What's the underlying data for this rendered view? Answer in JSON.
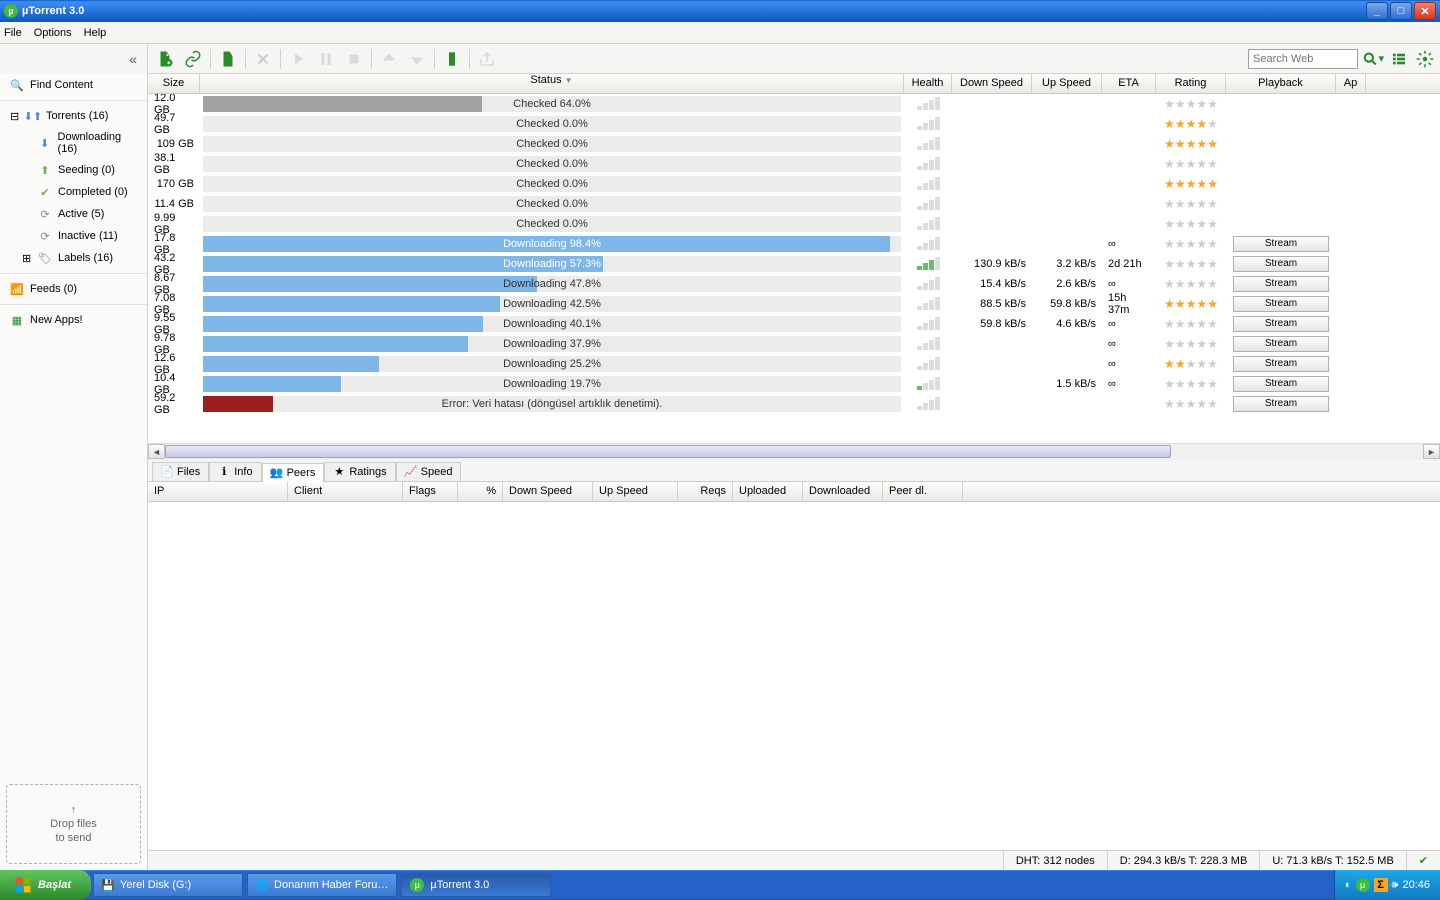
{
  "window": {
    "title": "µTorrent 3.0"
  },
  "menu": [
    "File",
    "Options",
    "Help"
  ],
  "search": {
    "placeholder": "Search Web"
  },
  "sidebar": {
    "find": "Find Content",
    "torrents": "Torrents (16)",
    "downloading": "Downloading (16)",
    "seeding": "Seeding (0)",
    "completed": "Completed (0)",
    "active": "Active (5)",
    "inactive": "Inactive (11)",
    "labels": "Labels (16)",
    "feeds": "Feeds (0)",
    "newapps": "New Apps!",
    "drop1": "Drop files",
    "drop2": "to send"
  },
  "columns": [
    "Size",
    "Status",
    "Health",
    "Down Speed",
    "Up Speed",
    "ETA",
    "Rating",
    "Playback",
    "Ap"
  ],
  "rows": [
    {
      "size": "12.0 GB",
      "status": "Checked 64.0%",
      "pct": 40,
      "barclass": "grey",
      "txtclass": "",
      "health": [
        0,
        0,
        0,
        0
      ],
      "down": "",
      "up": "",
      "eta": "",
      "stars": 0,
      "stream": false
    },
    {
      "size": "49.7 GB",
      "status": "Checked 0.0%",
      "pct": 0,
      "barclass": "grey",
      "txtclass": "",
      "health": [
        0,
        0,
        0,
        0
      ],
      "down": "",
      "up": "",
      "eta": "",
      "stars": 4,
      "stream": false
    },
    {
      "size": "109 GB",
      "status": "Checked 0.0%",
      "pct": 0,
      "barclass": "grey",
      "txtclass": "",
      "health": [
        0,
        0,
        0,
        0
      ],
      "down": "",
      "up": "",
      "eta": "",
      "stars": 5,
      "stream": false
    },
    {
      "size": "38.1 GB",
      "status": "Checked 0.0%",
      "pct": 0,
      "barclass": "grey",
      "txtclass": "",
      "health": [
        0,
        0,
        0,
        0
      ],
      "down": "",
      "up": "",
      "eta": "",
      "stars": 0,
      "stream": false
    },
    {
      "size": "170 GB",
      "status": "Checked 0.0%",
      "pct": 0,
      "barclass": "grey",
      "txtclass": "",
      "health": [
        0,
        0,
        0,
        0
      ],
      "down": "",
      "up": "",
      "eta": "",
      "stars": 5,
      "stream": false
    },
    {
      "size": "11.4 GB",
      "status": "Checked 0.0%",
      "pct": 0,
      "barclass": "grey",
      "txtclass": "",
      "health": [
        0,
        0,
        0,
        0
      ],
      "down": "",
      "up": "",
      "eta": "",
      "stars": 0,
      "stream": false
    },
    {
      "size": "9.99 GB",
      "status": "Checked 0.0%",
      "pct": 0,
      "barclass": "grey",
      "txtclass": "",
      "health": [
        0,
        0,
        0,
        0
      ],
      "down": "",
      "up": "",
      "eta": "",
      "stars": 0,
      "stream": false
    },
    {
      "size": "17.8 GB",
      "status": "Downloading 98.4%",
      "pct": 98.4,
      "barclass": "blue",
      "txtclass": "white",
      "health": [
        0,
        0,
        0,
        0
      ],
      "down": "",
      "up": "",
      "eta": "∞",
      "stars": 0,
      "stream": true
    },
    {
      "size": "43.2 GB",
      "status": "Downloading 57.3%",
      "pct": 57.3,
      "barclass": "blue",
      "txtclass": "white",
      "health": [
        1,
        1,
        1,
        0
      ],
      "down": "130.9 kB/s",
      "up": "3.2 kB/s",
      "eta": "2d 21h",
      "stars": 0,
      "stream": true
    },
    {
      "size": "8.67 GB",
      "status": "Downloading 47.8%",
      "pct": 47.8,
      "barclass": "blue",
      "txtclass": "",
      "health": [
        0,
        0,
        0,
        0
      ],
      "down": "15.4 kB/s",
      "up": "2.6 kB/s",
      "eta": "∞",
      "stars": 0,
      "stream": true
    },
    {
      "size": "7.08 GB",
      "status": "Downloading 42.5%",
      "pct": 42.5,
      "barclass": "blue",
      "txtclass": "",
      "health": [
        0,
        0,
        0,
        0
      ],
      "down": "88.5 kB/s",
      "up": "59.8 kB/s",
      "eta": "15h 37m",
      "stars": 5,
      "stream": true
    },
    {
      "size": "9.55 GB",
      "status": "Downloading 40.1%",
      "pct": 40.1,
      "barclass": "blue",
      "txtclass": "",
      "health": [
        0,
        0,
        0,
        0
      ],
      "down": "59.8 kB/s",
      "up": "4.6 kB/s",
      "eta": "∞",
      "stars": 0,
      "stream": true
    },
    {
      "size": "9.78 GB",
      "status": "Downloading 37.9%",
      "pct": 37.9,
      "barclass": "blue",
      "txtclass": "",
      "health": [
        0,
        0,
        0,
        0
      ],
      "down": "",
      "up": "",
      "eta": "∞",
      "stars": 0,
      "stream": true
    },
    {
      "size": "12.6 GB",
      "status": "Downloading 25.2%",
      "pct": 25.2,
      "barclass": "blue",
      "txtclass": "",
      "health": [
        0,
        0,
        0,
        0
      ],
      "down": "",
      "up": "",
      "eta": "∞",
      "stars": 2,
      "stream": true
    },
    {
      "size": "10.4 GB",
      "status": "Downloading 19.7%",
      "pct": 19.7,
      "barclass": "blue",
      "txtclass": "",
      "health": [
        1,
        0,
        0,
        0
      ],
      "down": "",
      "up": "1.5 kB/s",
      "eta": "∞",
      "stars": 0,
      "stream": true
    },
    {
      "size": "59.2 GB",
      "status": "Error: Veri hatası (döngüsel artıklık denetimi).",
      "pct": 10,
      "barclass": "red",
      "txtclass": "",
      "health": [
        0,
        0,
        0,
        0
      ],
      "down": "",
      "up": "",
      "eta": "",
      "stars": 0,
      "stream": true
    }
  ],
  "tabs": [
    "Files",
    "Info",
    "Peers",
    "Ratings",
    "Speed"
  ],
  "activeTab": 2,
  "peerCols": [
    "IP",
    "Client",
    "Flags",
    "%",
    "Down Speed",
    "Up Speed",
    "Reqs",
    "Uploaded",
    "Downloaded",
    "Peer dl."
  ],
  "status": {
    "dht": "DHT: 312 nodes",
    "down": "D: 294.3 kB/s T: 228.3 MB",
    "up": "U: 71.3 kB/s T: 152.5 MB"
  },
  "taskbar": {
    "start": "Başlat",
    "items": [
      "Yerel Disk (G:)",
      "Donanım Haber Foru…",
      "µTorrent 3.0"
    ],
    "time": "20:46"
  },
  "stream": "Stream"
}
